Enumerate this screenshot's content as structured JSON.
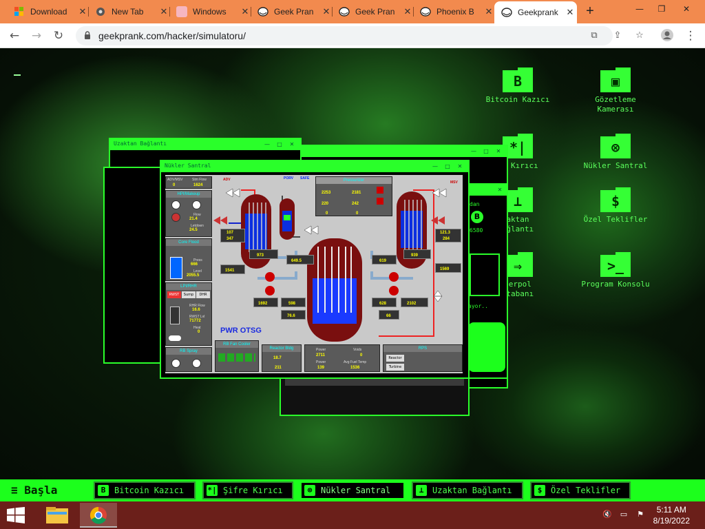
{
  "browser": {
    "tabs": [
      {
        "title": "Download",
        "icon": "windows-logo-icon"
      },
      {
        "title": "New Tab",
        "icon": "chrome-icon"
      },
      {
        "title": "Windows",
        "icon": "image-icon"
      },
      {
        "title": "Geek Pran",
        "icon": "trollface-icon"
      },
      {
        "title": "Geek Pran",
        "icon": "trollface-icon"
      },
      {
        "title": "Phoenix B",
        "icon": "trollface-icon"
      },
      {
        "title": "Geekprank",
        "icon": "trollface-icon"
      }
    ],
    "active_tab": 6,
    "url": "geekprank.com/hacker/simulatoru/"
  },
  "desktop_icons": [
    {
      "label": "Bitcoin Kazıcı",
      "glyph": "B"
    },
    {
      "label": "Gözetleme Kamerası",
      "glyph": "▣"
    },
    {
      "label": "re Kırıcı",
      "glyph": "*|"
    },
    {
      "label": "Nükler Santral",
      "glyph": "⊗"
    },
    {
      "label": "aktan ağlantı",
      "glyph": "⊥"
    },
    {
      "label": "Özel Teklifler",
      "glyph": "$"
    },
    {
      "label": "terpol itabanı",
      "glyph": "⇒"
    },
    {
      "label": "Program Konsolu",
      "glyph": ">_"
    }
  ],
  "windows": {
    "remote": {
      "title": "Uzaktan Bağlantı"
    },
    "nuclear": {
      "title": "Nükler Santral"
    }
  },
  "background_text": {
    "mining_value": "6580",
    "partial": "ayor..",
    "label": "dan"
  },
  "reactor": {
    "adv_msv": "ADV/MSV",
    "stm_flow_label": "Stm Flow",
    "adv_val": "0",
    "stm_val": "1624",
    "hpi_makeup": "HPI/Makeup",
    "flow_label": "Flow",
    "flow_val": "21.4",
    "letdown_label": "Letdown",
    "letdown_val": "24.5",
    "core_flood": "Core Flood",
    "press_label": "Press",
    "press_val": "666",
    "level_label": "Level",
    "level_val": "2055.5",
    "lpi_rhr": "LPI/RHR",
    "rwst": "RWST",
    "sump": "Sump",
    "dhr": "DHR",
    "rhr_flow_label": "RHR Flow",
    "rhr_flow_val": "16.6",
    "rwst_lvl_label": "RWST Lvl",
    "rwst_lvl_val": "71772",
    "heat_label": "Heat",
    "heat_val": "0",
    "rb_spray": "RB Spray",
    "adv_left": "ADV",
    "porv": "PORV",
    "safe": "SAFE",
    "msv": "MSV",
    "pressurizer": "Pressurizer",
    "pressure_val": "2253",
    "press_sp_val": "2181",
    "level_p_val": "220",
    "level_sp_val": "242",
    "heater_val": "0",
    "porv_val": "0",
    "sg_lvl_left": "107",
    "wr_lvl_left": "347",
    "feed_flow_left": "1541",
    "sg_temp_left": "973",
    "pzr_temp": "649.5",
    "cold_temp_left": "1692",
    "hot_temp_left": "598",
    "delta_left": "76.6",
    "sg_temp_right": "939",
    "cold_temp_right": "619",
    "sg_lvl_right": "121.3",
    "wr_lvl_right": "284",
    "feed_flow_right": "1569",
    "cold_temp_right2": "628",
    "hot_temp_right2": "2102",
    "delta_right": "66",
    "pwr_label": "PWR OTSG",
    "rb_fan_cooler": "RB Fan Cooler",
    "reactor_bldg": "Reactor Bldg",
    "rb_pressure": "18.7",
    "rb_temp": "211",
    "power_label": "Power",
    "power_val": "2711",
    "voids_label": "Voids",
    "voids_val": "0",
    "power2_label": "Power",
    "power2_val": "139",
    "fuel_temp_label": "Avg Fuel Temp",
    "fuel_temp_val": "1536",
    "rps_label": "RPS",
    "reactor_btn": "Reactor",
    "turbine_btn": "Turbine"
  },
  "app_taskbar": {
    "start": "Başla",
    "items": [
      {
        "icon": "B",
        "label": "Bitcoin Kazıcı"
      },
      {
        "icon": "*|",
        "label": "Şifre Kırıcı"
      },
      {
        "icon": "⊗",
        "label": "Nükler Santral"
      },
      {
        "icon": "⊥",
        "label": "Uzaktan Bağlantı"
      },
      {
        "icon": "$",
        "label": "Özel Teklifler"
      }
    ]
  },
  "os_taskbar": {
    "time": "5:11 AM",
    "date": "8/19/2022"
  }
}
